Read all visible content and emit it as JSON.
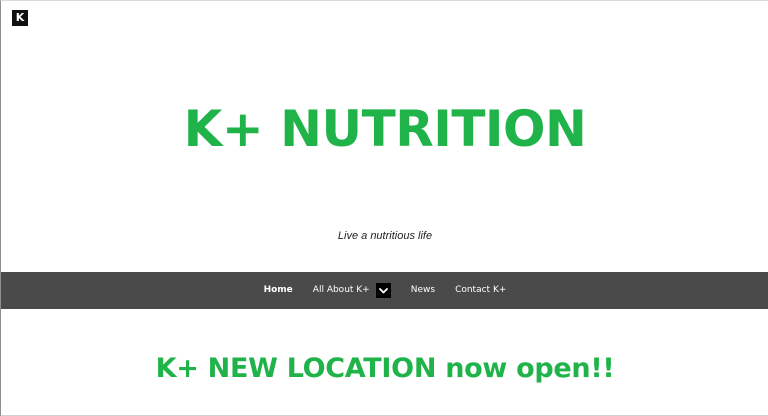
{
  "site": {
    "logo_letter": "K",
    "title": "K+ NUTRITION",
    "tagline": "Live a nutritious life",
    "colors": {
      "brand_green": "#1fb34a",
      "nav_background": "#4a4a4a",
      "nav_text": "#ffffff"
    }
  },
  "nav": {
    "items": [
      {
        "label": "Home",
        "active": true
      },
      {
        "label": "All About K+",
        "has_dropdown": true,
        "dropdown_icon": "chevron-down-icon"
      },
      {
        "label": "News"
      },
      {
        "label": "Contact K+"
      }
    ]
  },
  "main": {
    "heading": "K+ NEW LOCATION now open!!"
  }
}
